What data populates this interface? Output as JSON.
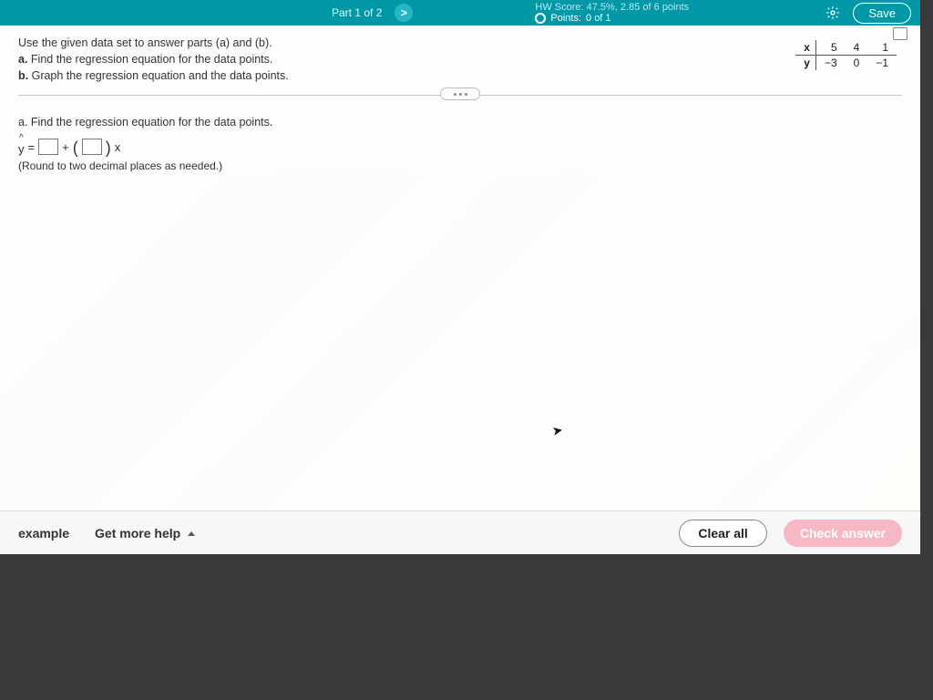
{
  "header": {
    "part_label": "Part 1 of 2",
    "nav_arrow": ">",
    "score_line": "HW Score: 47.5%, 2.85 of 6 points",
    "points_label": "Points:",
    "points_value": "0 of 1",
    "save_label": "Save"
  },
  "problem": {
    "intro": "Use the given data set to answer parts (a) and (b).",
    "pa_label": "a.",
    "pa_text": "Find the regression equation for the data points.",
    "pb_label": "b.",
    "pb_text": "Graph the regression equation and the data points.",
    "table": {
      "xlabel": "x",
      "ylabel": "y",
      "x": [
        "5",
        "4",
        "1"
      ],
      "y": [
        "−3",
        "0",
        "−1"
      ]
    }
  },
  "parta": {
    "prompt": "a. Find the regression equation for the data points.",
    "yhat": "y",
    "equals": "=",
    "plus": "+",
    "xvar": "x",
    "round_note": "(Round to two decimal places as needed.)"
  },
  "footer": {
    "example": "example",
    "help": "Get more help",
    "clear": "Clear all",
    "check": "Check answer"
  }
}
